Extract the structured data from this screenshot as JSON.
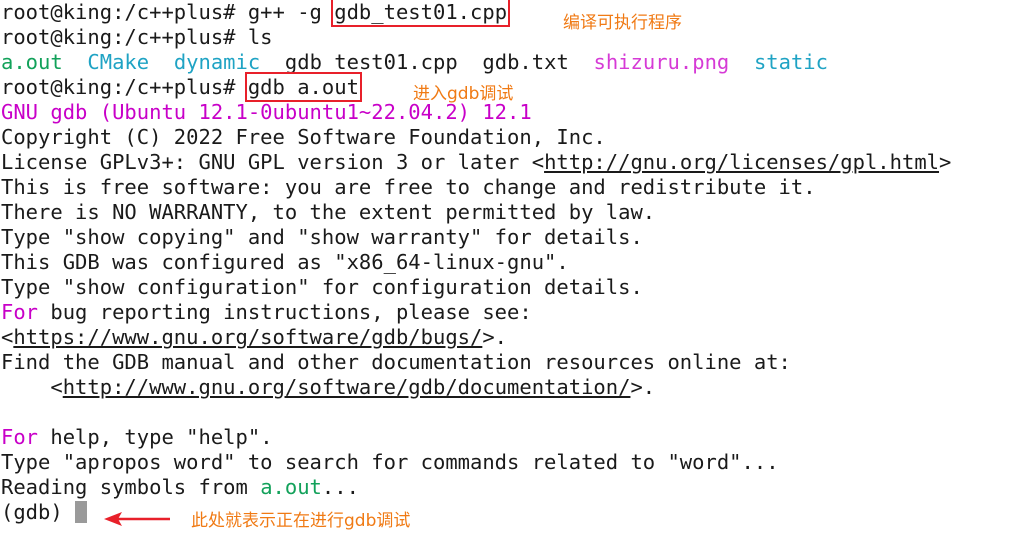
{
  "lines": {
    "l1": {
      "prompt": "root@king:/c++plus#",
      "cmd_pre": " g++ -g ",
      "cmd_file": "gdb_test01.cpp"
    },
    "l2": {
      "prompt": "root@king:/c++plus#",
      "cmd": " ls"
    },
    "l3": {
      "f1": "a.out",
      "f2": "CMake",
      "f3": "dynamic",
      "f4": "gdb_test01.cpp",
      "f5": "gdb.txt",
      "f6": "shizuru.png",
      "f7": "static"
    },
    "l4": {
      "prompt": "root@king:/c++plus#",
      "cmd": "gdb a.out"
    },
    "l5": {
      "text": "GNU gdb (Ubuntu 12.1-0ubuntu1~22.04.2) 12.1"
    },
    "l6": {
      "text": "Copyright (C) 2022 Free Software Foundation, Inc."
    },
    "l7": {
      "pre": "License GPLv3+: GNU GPL version 3 or later <",
      "link": "http://gnu.org/licenses/gpl.html",
      "post": ">"
    },
    "l8": {
      "text": "This is free software: you are free to change and redistribute it."
    },
    "l9": {
      "text": "There is NO WARRANTY, to the extent permitted by law."
    },
    "l10": {
      "text": "Type \"show copying\" and \"show warranty\" for details."
    },
    "l11": {
      "text": "This GDB was configured as \"x86_64-linux-gnu\"."
    },
    "l12": {
      "text": "Type \"show configuration\" for configuration details."
    },
    "l13": {
      "for": "For",
      "rest": " bug reporting instructions, please see:"
    },
    "l14": {
      "pre": "<",
      "link": "https://www.gnu.org/software/gdb/bugs/",
      "post": ">."
    },
    "l15": {
      "text": "Find the GDB manual and other documentation resources online at:"
    },
    "l16": {
      "pre": "    <",
      "link": "http://www.gnu.org/software/gdb/documentation/",
      "post": ">."
    },
    "l18": {
      "for": "For",
      "rest": " help, type \"help\"."
    },
    "l19": {
      "text": "Type \"apropos word\" to search for commands related to \"word\"..."
    },
    "l20": {
      "pre": "Reading symbols from ",
      "file": "a.out",
      "post": "..."
    },
    "l21": {
      "prompt": "(gdb) "
    }
  },
  "annotations": {
    "compile": "编译可执行程序",
    "enter_gdb": "进入gdb调试",
    "debugging": "此处就表示正在进行gdb调试"
  },
  "colors": {
    "magenta": "#c800c8",
    "cyan": "#1fa3c4",
    "green": "#12a15a",
    "annotation_orange": "#f07a14",
    "highlight_box_red": "#e8202a"
  }
}
